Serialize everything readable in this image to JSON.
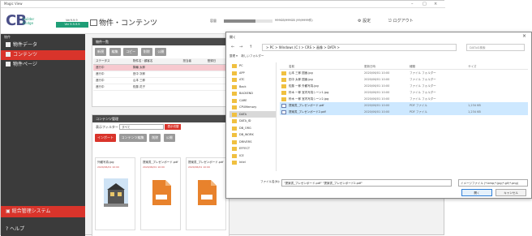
{
  "app": {
    "title": "Magic View",
    "logo_main": "CB",
    "logo_sub_line1": "Builder",
    "logo_sub_line2": "Bridge",
    "version": "Ver9.9.9",
    "version_badge": "Ver 9.9.9.9",
    "page_title": "物件・コンテンツ",
    "usage_label": "容量",
    "usage_value": 0.65,
    "usage_text": "999GB/999GB (99/9999件)",
    "settings_label": "設定",
    "logout_label": "ログアウト",
    "window_controls": [
      "–",
      "□",
      "×"
    ]
  },
  "sidebar": {
    "heading": "物件",
    "items": [
      {
        "label": "物件データ",
        "active": false
      },
      {
        "label": "コンテンツ",
        "active": true
      },
      {
        "label": "物件ページ",
        "active": false
      }
    ],
    "system_label": "総合管理システム",
    "help_label": "ヘルプ"
  },
  "property_panel": {
    "title": "物件一覧",
    "buttons": [
      "新規",
      "編集",
      "コピー",
      "削除",
      "公開"
    ],
    "columns": [
      "ステータス",
      "物件名・顧客名",
      "担当者",
      "登録日"
    ],
    "rows": [
      {
        "status": "進行中",
        "name": "箕輪 太郎",
        "selected": true
      },
      {
        "status": "進行中",
        "name": "田中 次郎",
        "selected": false
      },
      {
        "status": "進行中",
        "name": "山本 三郎",
        "selected": false
      },
      {
        "status": "進行中",
        "name": "佐藤 花子",
        "selected": false
      }
    ]
  },
  "content_panel": {
    "title": "コンテンツ管理",
    "filter_label": "表示フィルター",
    "filter_value": "すべて",
    "filter_button": "表示切替",
    "buttons": [
      "インポート",
      "コンテンツ編集",
      "削除",
      "公開"
    ],
    "cards": [
      {
        "name": "外観写真.jpg",
        "date": "2020/06/01 10:00"
      },
      {
        "name": "提案書_プレゼンボード.pdf",
        "date": "2020/06/01 10:00"
      },
      {
        "name": "提案書_プレゼンボード.pdf",
        "date": "2020/06/01 10:00"
      }
    ]
  },
  "dialog": {
    "title": "開く",
    "close": "×",
    "nav": [
      "←",
      "→",
      "↑"
    ],
    "path": "> PC > Windows (C:) > CRS > 画像 > DATA >",
    "search_placeholder": "DATAの検索",
    "organize_label": "整理 ▾",
    "new_folder_label": "新しいフォルダー",
    "tree": [
      "PC",
      "APP",
      "ATC",
      "Back",
      "BACKEND",
      "CARE",
      "CPUMemory",
      "DATA",
      "DATA_ID",
      "DB_ORG",
      "DB_WORK",
      "DRIVERS",
      "EFFECT",
      "ICE",
      "Intel"
    ],
    "active_tree_index": 7,
    "columns": [
      "名前",
      "更新日時",
      "種類",
      "サイズ"
    ],
    "files": [
      {
        "name": "山本 三郎 図面.jpg",
        "date": "2020/06/01 10:00",
        "type": "ファイル フォルダー",
        "size": "",
        "pdf": false,
        "selected": false
      },
      {
        "name": "田中 太郎 図面.jpg",
        "date": "2020/06/01 10:00",
        "type": "ファイル フォルダー",
        "size": "",
        "pdf": false,
        "selected": false
      },
      {
        "name": "佐藤 一郎 外観写真.jpg",
        "date": "2020/06/01 10:00",
        "type": "ファイル フォルダー",
        "size": "",
        "pdf": false,
        "selected": false
      },
      {
        "name": "鈴木 一郎 室内写真シーン1.jpg",
        "date": "2020/06/01 10:00",
        "type": "ファイル フォルダー",
        "size": "",
        "pdf": false,
        "selected": false
      },
      {
        "name": "鈴木 一郎 室内写真シーン2.jpg",
        "date": "2020/06/01 10:00",
        "type": "ファイル フォルダー",
        "size": "",
        "pdf": false,
        "selected": false
      },
      {
        "name": "提案書_プレゼンボード.pdf",
        "date": "2020/06/01 10:00",
        "type": "PDF ファイル",
        "size": "1,234 KB",
        "pdf": true,
        "selected": true
      },
      {
        "name": "提案書_プレゼンボード2.pdf",
        "date": "2020/06/01 10:00",
        "type": "PDF ファイル",
        "size": "1,234 KB",
        "pdf": true,
        "selected": true
      }
    ],
    "filename_label": "ファイル名(N):",
    "filename_value": "\"提案書_プレゼンボード.pdf\" \"提案書_プレゼンボード2.pdf\"",
    "filetype_value": "イメージファイル (*.bmp;*.jpg;*.gif;*.png)",
    "open_button": "開く",
    "cancel_button": "キャンセル"
  }
}
